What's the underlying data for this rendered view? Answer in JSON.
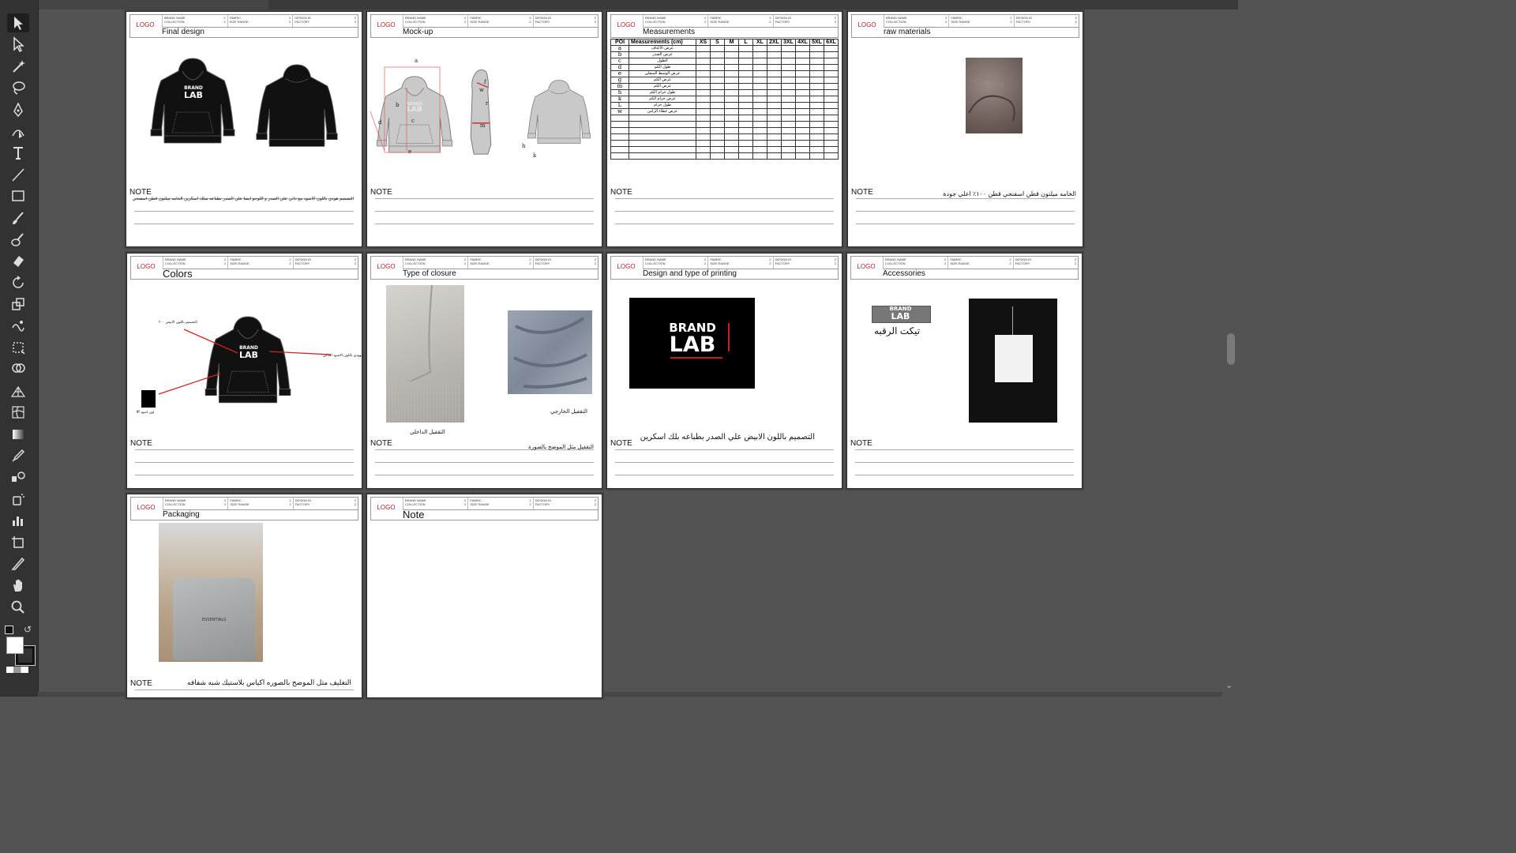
{
  "tools": [
    "selection-tool",
    "direct-selection-tool",
    "magic-wand-tool",
    "lasso-tool",
    "pen-tool",
    "curvature-tool",
    "type-tool",
    "line-tool",
    "rectangle-tool",
    "paintbrush-tool",
    "blob-brush-tool",
    "eraser-tool",
    "rotate-tool",
    "scale-tool",
    "warp-tool",
    "free-transform-tool",
    "shape-builder-tool",
    "perspective-grid-tool",
    "mesh-tool",
    "gradient-tool",
    "eyedropper-tool",
    "blend-tool",
    "symbol-sprayer-tool",
    "column-graph-tool",
    "artboard-tool",
    "slice-tool",
    "hand-tool",
    "zoom-tool"
  ],
  "header": {
    "logo": "LOGO",
    "col1_top": "BRAND NAME",
    "col1_bot": "COLLECTION",
    "col2_top": "FABRIC",
    "col2_bot": "SIZE RANGE",
    "col3_top": "DESIGN ID",
    "col3_bot": "FACTORY",
    "value": "2"
  },
  "note_label": "NOTE",
  "brand": {
    "line1": "BRAND",
    "line2": "LAB"
  },
  "pages": {
    "p1": {
      "title": "Final design",
      "note_text": "التصميم هودي باللون الاسود مع ذاتي علي الصدر و اللوجو ايضا علي الصدر بطباعه سلك اسكرين الخامه ميلتون قطن اسفنجي ٢٠٠"
    },
    "p2": {
      "title": "Mock-up",
      "labels": {
        "a": "a",
        "b": "b",
        "c": "c",
        "d": "d",
        "e": "e",
        "f": "f",
        "h": "h",
        "k": "k",
        "m": "m",
        "w": "w",
        "r": "r"
      }
    },
    "p3": {
      "title": "Measurements"
    },
    "p4": {
      "title": "raw materials",
      "note_text": "الخامه ميلتون قطن اسفنجي  قطن ١٠٠٪ اعلي جودة"
    },
    "p5": {
      "title": "Colors",
      "label_white": "التصميم باللون الابيض ٢٠٠",
      "label_other": "باقي الهودي باللون الاسود الداكن",
      "label_black": "لون اسود fff"
    },
    "p6": {
      "title": "Type of closure",
      "caption_inner": "التقفيل الداخلي",
      "caption_outer": "التقفيل الخارجي",
      "note_text": "التقفيل مثل الموضح بالصورة"
    },
    "p7": {
      "title": "Design and type of printing",
      "note_text": "التصميم باللون الابيض علي الصدر بطباعه بلك اسكرين"
    },
    "p8": {
      "title": "Accessories",
      "neck_label": "تيكت الرقبه"
    },
    "p9": {
      "title": "Packaging",
      "note_text": "التغليف مثل الموضح بالصوره اكياس بلاستيك شبه شفافه",
      "bag_text": "ESSENTIALS"
    },
    "p10": {
      "title": "Note"
    }
  },
  "measurements": {
    "columns": [
      "POI",
      "Measurements (cm)",
      "XS",
      "S",
      "M",
      "L",
      "XL",
      "2XL",
      "3XL",
      "4XL",
      "5XL",
      "6XL"
    ],
    "rows": [
      {
        "poi": "a",
        "label": "عرض الاكتاف"
      },
      {
        "poi": "b",
        "label": "عرض الصدر"
      },
      {
        "poi": "c",
        "label": "الطول"
      },
      {
        "poi": "d",
        "label": "طول الكم"
      },
      {
        "poi": "e",
        "label": "عرض الوسط السفلي"
      },
      {
        "poi": "g",
        "label": "عرض الكم"
      },
      {
        "poi": "m",
        "label": "عرض الكم"
      },
      {
        "poi": "h",
        "label": "طول حزام الكم"
      },
      {
        "poi": "k",
        "label": "عرض حزام الكم"
      },
      {
        "poi": "L",
        "label": "طول حزام"
      },
      {
        "poi": "w",
        "label": "عرض غطاء الراس"
      },
      {
        "poi": "",
        "label": ""
      },
      {
        "poi": "",
        "label": ""
      },
      {
        "poi": "",
        "label": ""
      },
      {
        "poi": "",
        "label": ""
      },
      {
        "poi": "",
        "label": ""
      },
      {
        "poi": "",
        "label": ""
      },
      {
        "poi": "",
        "label": ""
      }
    ]
  },
  "colors": {
    "canvas": "#535353",
    "toolbar": "#323232",
    "logo_red": "#b02020",
    "hoodie_black": "#111111",
    "hoodie_grey": "#c9c9c9",
    "fabric_taupe": "#7a6a66",
    "arrow_red": "#d42020"
  }
}
